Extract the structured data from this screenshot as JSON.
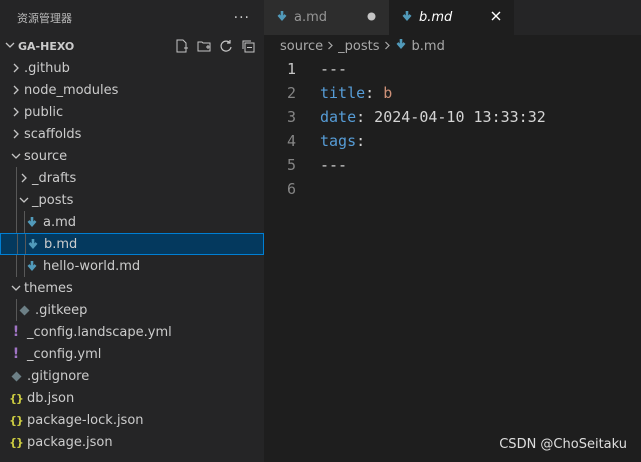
{
  "explorer": {
    "title": "资源管理器",
    "more": "···",
    "section": "GA-HEXO",
    "items": [
      {
        "label": ".github",
        "kind": "folder-closed",
        "depth": 0
      },
      {
        "label": "node_modules",
        "kind": "folder-closed",
        "depth": 0
      },
      {
        "label": "public",
        "kind": "folder-closed",
        "depth": 0
      },
      {
        "label": "scaffolds",
        "kind": "folder-closed",
        "depth": 0
      },
      {
        "label": "source",
        "kind": "folder-open",
        "depth": 0
      },
      {
        "label": "_drafts",
        "kind": "folder-closed",
        "depth": 1
      },
      {
        "label": "_posts",
        "kind": "folder-open",
        "depth": 1
      },
      {
        "label": "a.md",
        "kind": "md",
        "depth": 2
      },
      {
        "label": "b.md",
        "kind": "md",
        "depth": 2,
        "selected": true
      },
      {
        "label": "hello-world.md",
        "kind": "md",
        "depth": 2
      },
      {
        "label": "themes",
        "kind": "folder-open",
        "depth": 0
      },
      {
        "label": ".gitkeep",
        "kind": "git",
        "depth": 1
      },
      {
        "label": "_config.landscape.yml",
        "kind": "yml",
        "depth": 0
      },
      {
        "label": "_config.yml",
        "kind": "yml",
        "depth": 0
      },
      {
        "label": ".gitignore",
        "kind": "git",
        "depth": 0
      },
      {
        "label": "db.json",
        "kind": "json",
        "depth": 0
      },
      {
        "label": "package-lock.json",
        "kind": "json",
        "depth": 0
      },
      {
        "label": "package.json",
        "kind": "json",
        "depth": 0
      }
    ]
  },
  "tabs": [
    {
      "label": "a.md",
      "modified": true,
      "active": false
    },
    {
      "label": "b.md",
      "modified": false,
      "active": true
    }
  ],
  "breadcrumb": [
    "source",
    "_posts",
    "b.md"
  ],
  "editor": {
    "lines": [
      {
        "n": "1",
        "tokens": [
          {
            "t": "---",
            "c": "hr"
          }
        ]
      },
      {
        "n": "2",
        "tokens": [
          {
            "t": "title",
            "c": "k"
          },
          {
            "t": ": ",
            "c": "d"
          },
          {
            "t": "b",
            "c": "v"
          }
        ]
      },
      {
        "n": "3",
        "tokens": [
          {
            "t": "date",
            "c": "k"
          },
          {
            "t": ": 2024-04-10 13:33:32",
            "c": "d"
          }
        ]
      },
      {
        "n": "4",
        "tokens": [
          {
            "t": "tags",
            "c": "k"
          },
          {
            "t": ":",
            "c": "d"
          }
        ]
      },
      {
        "n": "5",
        "tokens": [
          {
            "t": "---",
            "c": "hr"
          }
        ]
      },
      {
        "n": "6",
        "tokens": []
      }
    ],
    "current_line": "1"
  },
  "watermark": "CSDN @ChoSeitaku",
  "colors": {
    "md_icon": "#519aba",
    "yml_icon": "#a074c4",
    "json_icon": "#cbcb41",
    "git_icon": "#6d8086",
    "selection": "#04395e"
  }
}
